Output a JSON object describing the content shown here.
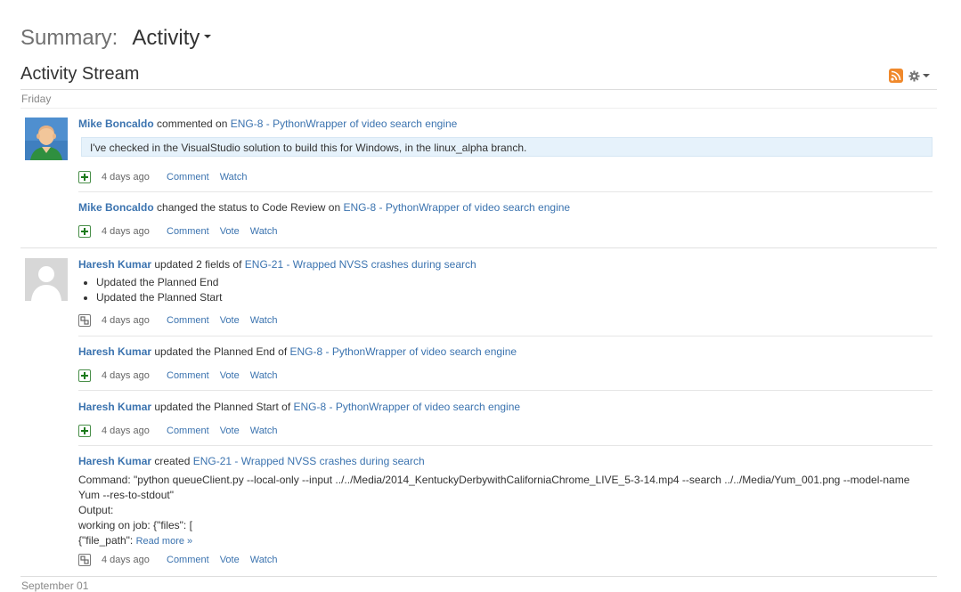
{
  "header": {
    "summary_label": "Summary:",
    "view_label": "Activity"
  },
  "stream": {
    "title": "Activity Stream",
    "rss_icon": "rss-feed-icon",
    "settings_icon": "gear-icon"
  },
  "days": [
    {
      "label": "Friday"
    },
    {
      "label": "September 01"
    }
  ],
  "groups": [
    {
      "user": "Mike Boncaldo",
      "avatar": "user-avatar-bald-man",
      "entries": [
        {
          "user": "Mike Boncaldo",
          "action_text": " commented on ",
          "issue": "ENG-8 - PythonWrapper of video search engine",
          "comment": "I've checked in the VisualStudio solution to build this for Windows, in the linux_alpha branch.",
          "time": "4 days ago",
          "actions": [
            "Comment",
            "Watch"
          ]
        },
        {
          "user": "Mike Boncaldo",
          "action_text": " changed the status to Code Review on ",
          "issue": "ENG-8 - PythonWrapper of video search engine",
          "time": "4 days ago",
          "actions": [
            "Comment",
            "Vote",
            "Watch"
          ]
        }
      ]
    },
    {
      "user": "Haresh Kumar",
      "avatar": "default-user-avatar",
      "entries": [
        {
          "user": "Haresh Kumar",
          "action_text": " updated 2 fields of ",
          "issue": "ENG-21 - Wrapped NVSS crashes during search",
          "bullets": [
            "Updated the Planned End",
            "Updated the Planned Start"
          ],
          "time": "4 days ago",
          "actions": [
            "Comment",
            "Vote",
            "Watch"
          ]
        },
        {
          "user": "Haresh Kumar",
          "action_text": " updated the Planned End of ",
          "issue": "ENG-8 - PythonWrapper of video search engine",
          "time": "4 days ago",
          "actions": [
            "Comment",
            "Vote",
            "Watch"
          ]
        },
        {
          "user": "Haresh Kumar",
          "action_text": " updated the Planned Start of ",
          "issue": "ENG-8 - PythonWrapper of video search engine",
          "time": "4 days ago",
          "actions": [
            "Comment",
            "Vote",
            "Watch"
          ]
        },
        {
          "user": "Haresh Kumar",
          "action_text": " created ",
          "issue": "ENG-21 - Wrapped NVSS crashes during search",
          "description": {
            "line1": "Command: \"python queueClient.py --local-only --input ../../Media/2014_KentuckyDerbywithCaliforniaChrome_LIVE_5-3-14.mp4 --search ../../Media/Yum_001.png --model-name",
            "line2": "Yum --res-to-stdout\"",
            "line3": "Output:",
            "line4": "working on job: {\"files\": [",
            "line5_prefix": "{\"file_path\": ",
            "read_more": "Read more »"
          },
          "time": "4 days ago",
          "actions": [
            "Comment",
            "Vote",
            "Watch"
          ]
        }
      ]
    }
  ]
}
